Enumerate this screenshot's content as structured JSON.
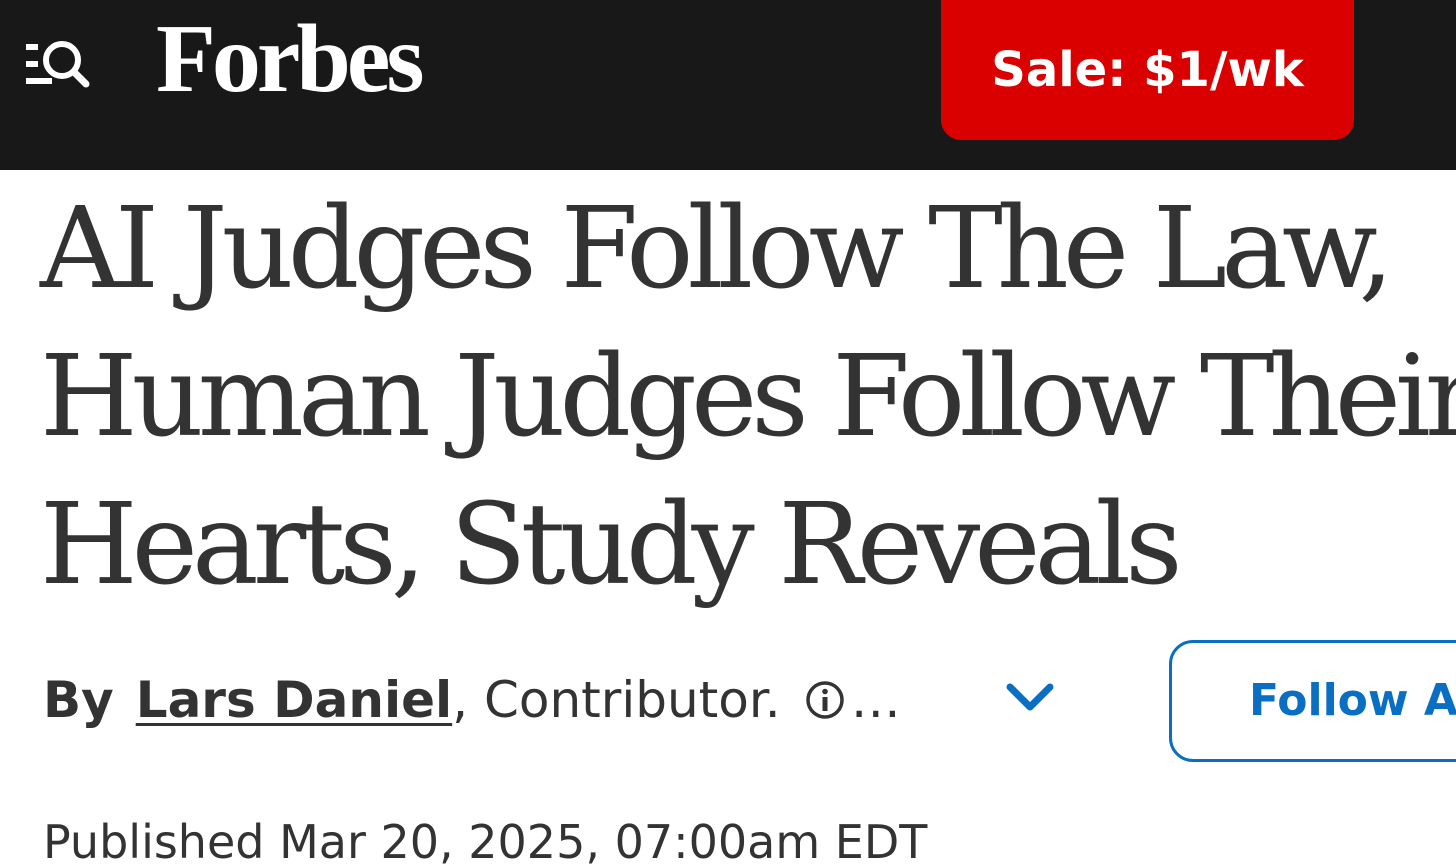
{
  "header": {
    "brand": "Forbes",
    "sale_button": "Sale: $1/wk",
    "menu_icon": "menu-search-icon"
  },
  "article": {
    "headline_lines": [
      "AI Judges Follow The Law,",
      "Human Judges Follow Their",
      "Hearts, Study Reveals"
    ],
    "byline": {
      "by": "By",
      "author": "Lars Daniel",
      "role": ", Contributor.",
      "ellipsis": "…",
      "info_icon": "info-icon",
      "expand_icon": "chevron-down-icon"
    },
    "follow_button": "Follow Author",
    "published": "Published Mar 20, 2025, 07:00am EDT"
  },
  "colors": {
    "header_bg": "#181818",
    "sale_red": "#db0000",
    "text": "#333333",
    "link_blue": "#0a6fc2"
  }
}
